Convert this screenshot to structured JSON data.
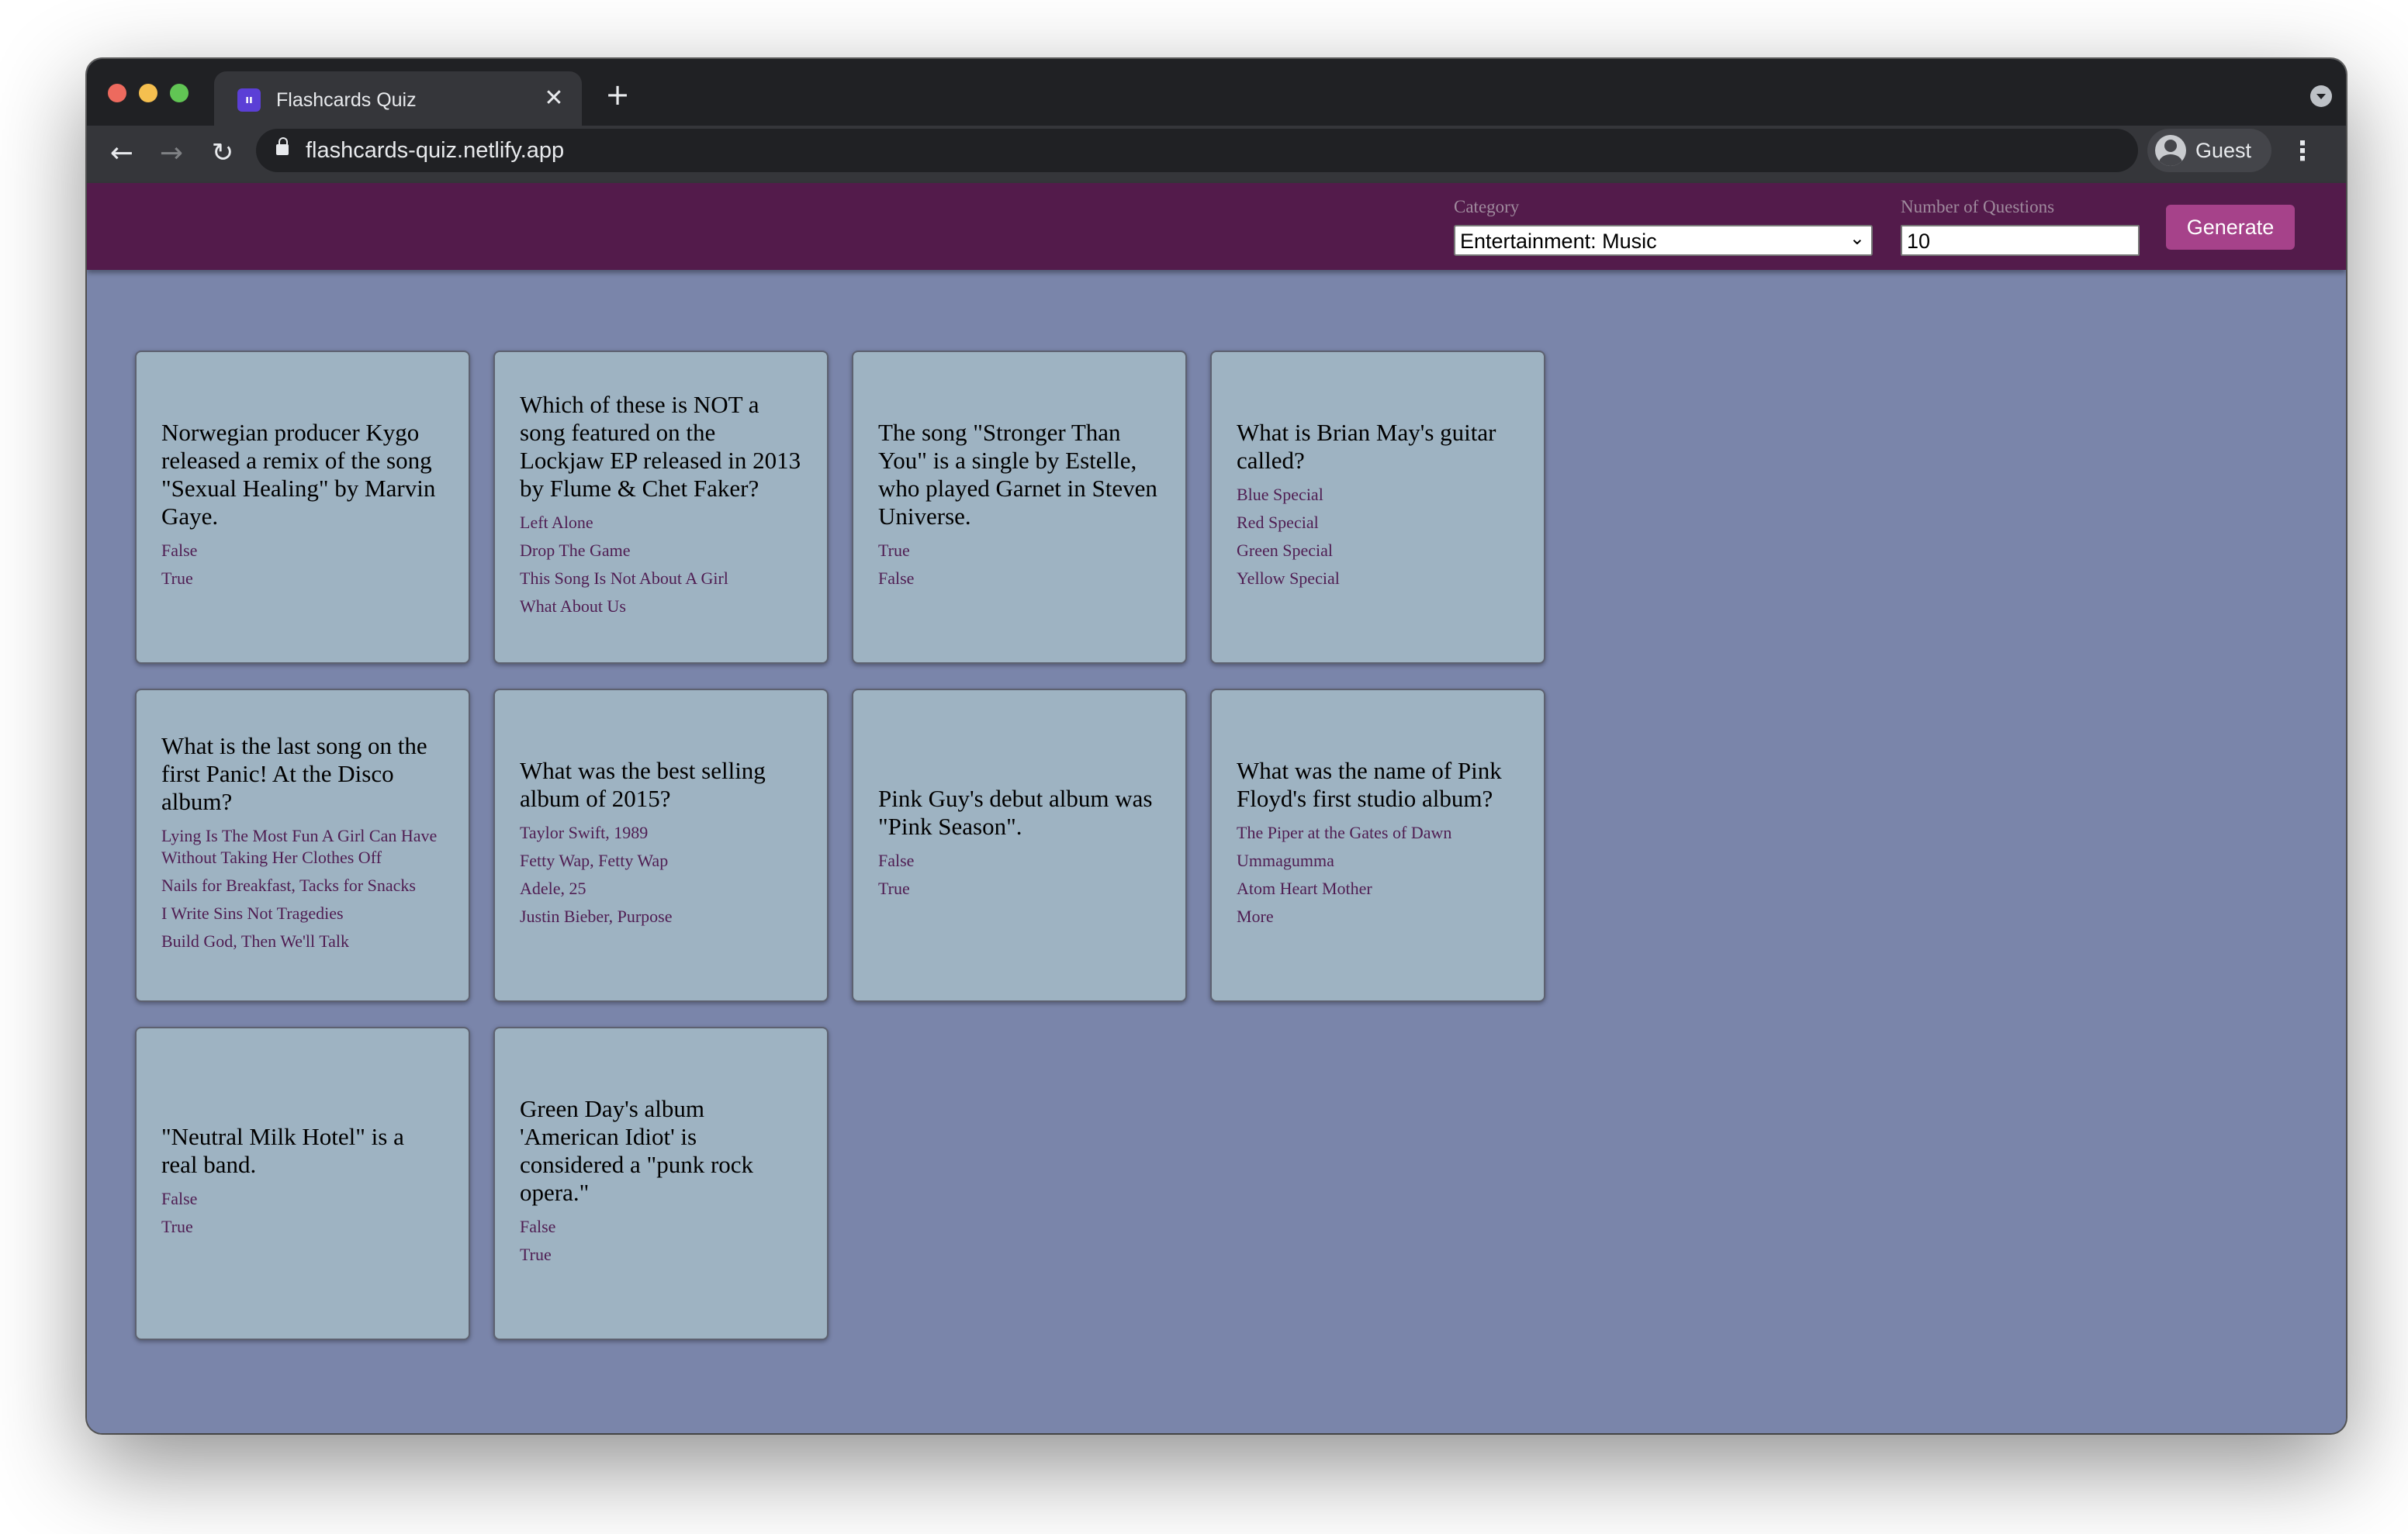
{
  "browser": {
    "tab_title": "Flashcards Quiz",
    "favicon_glyph": "ıı",
    "close_glyph": "✕",
    "new_tab_glyph": "+",
    "back_glyph": "←",
    "forward_glyph": "→",
    "reload_glyph": "↻",
    "url": "flashcards-quiz.netlify.app",
    "profile_label": "Guest",
    "menu_glyph": "⋮"
  },
  "header": {
    "category_label": "Category",
    "category_value": "Entertainment: Music",
    "number_label": "Number of Questions",
    "number_value": "10",
    "generate_label": "Generate",
    "select_chevron": "⌄"
  },
  "colors": {
    "header_bg": "#531b4b",
    "page_bg": "#7a85aa",
    "card_bg": "#9eb3c2",
    "button_bg": "#a6428a",
    "answer_text": "#4f1d52"
  },
  "cards": [
    {
      "question": "Norwegian producer Kygo released a remix of the song \"Sexual Healing\" by Marvin Gaye.",
      "answers": [
        "False",
        "True"
      ]
    },
    {
      "question": "Which of these is NOT a song featured on the Lockjaw EP released in 2013 by Flume & Chet Faker?",
      "answers": [
        "Left Alone",
        "Drop The Game",
        "This Song Is Not About A Girl",
        "What About Us"
      ]
    },
    {
      "question": "The song \"Stronger Than You\" is a single by Estelle, who played Garnet in Steven Universe.",
      "answers": [
        "True",
        "False"
      ]
    },
    {
      "question": "What is Brian May's guitar called?",
      "answers": [
        "Blue Special",
        "Red Special",
        "Green Special",
        "Yellow Special"
      ]
    },
    {
      "question": "What is the last song on the first Panic! At the Disco album?",
      "answers": [
        "Lying Is The Most Fun A Girl Can Have Without Taking Her Clothes Off",
        "Nails for Breakfast, Tacks for Snacks",
        "I Write Sins Not Tragedies",
        "Build God, Then We'll Talk"
      ]
    },
    {
      "question": "What was the best selling album of 2015?",
      "answers": [
        "Taylor Swift, 1989",
        "Fetty Wap, Fetty Wap",
        "Adele, 25",
        "Justin Bieber, Purpose"
      ]
    },
    {
      "question": "Pink Guy's debut album was \"Pink Season\".",
      "answers": [
        "False",
        "True"
      ]
    },
    {
      "question": "What was the name of Pink Floyd's first studio album?",
      "answers": [
        "The Piper at the Gates of Dawn",
        "Ummagumma",
        "Atom Heart Mother",
        "More"
      ]
    },
    {
      "question": "\"Neutral Milk Hotel\" is a real band.",
      "answers": [
        "False",
        "True"
      ]
    },
    {
      "question": "Green Day's album 'American Idiot' is considered a \"punk rock opera.\"",
      "answers": [
        "False",
        "True"
      ]
    }
  ]
}
